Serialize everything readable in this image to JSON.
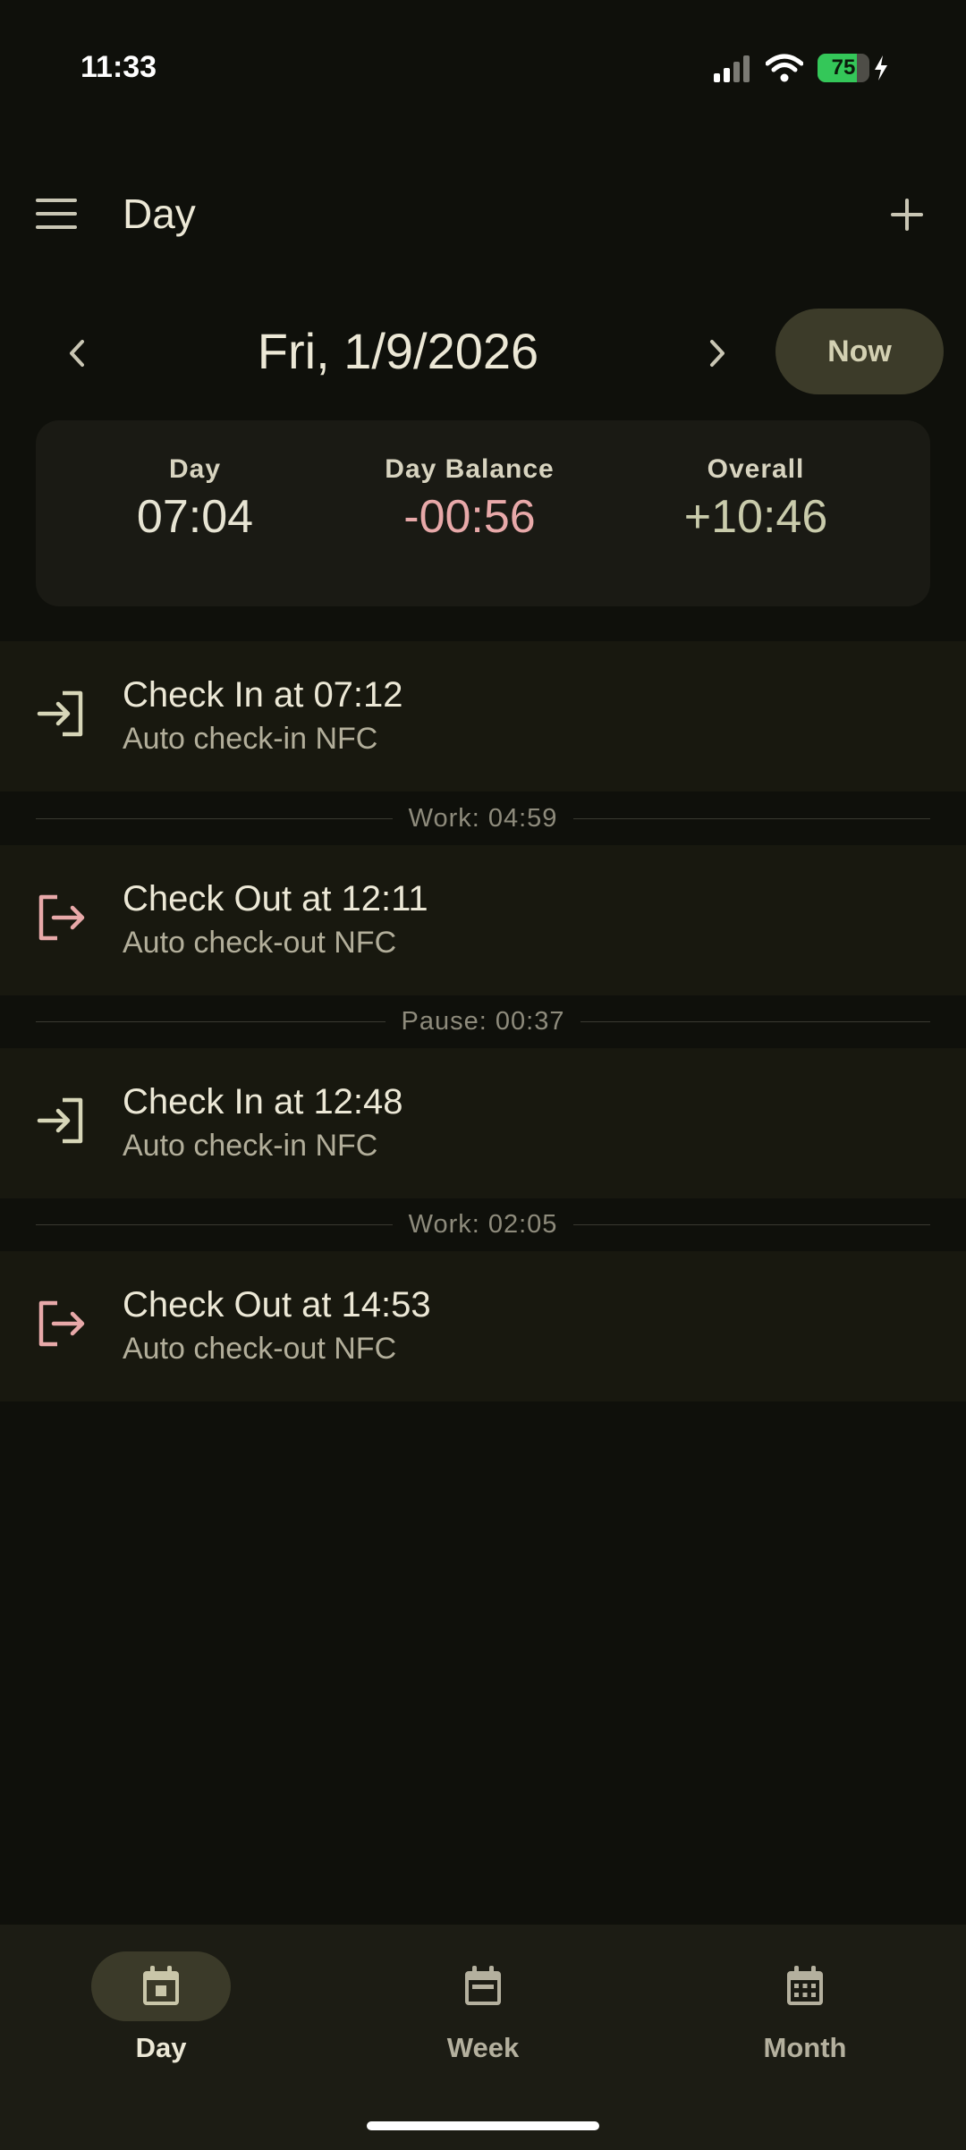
{
  "status_bar": {
    "time": "11:33",
    "battery_percent": "75"
  },
  "app_bar": {
    "title": "Day",
    "menu_icon": "menu-icon",
    "add_icon": "plus-icon"
  },
  "date_nav": {
    "date": "Fri, 1/9/2026",
    "now_label": "Now"
  },
  "summary": {
    "day": {
      "label": "Day",
      "value": "07:04"
    },
    "day_balance": {
      "label": "Day Balance",
      "value": "-00:56",
      "color": "#e8a9a9"
    },
    "overall": {
      "label": "Overall",
      "value": "+10:46",
      "color": "#c9cbab"
    }
  },
  "entries": [
    {
      "title": "Check In at 07:12",
      "subtitle": "Auto check-in NFC",
      "type": "check-in",
      "icon": "login-icon",
      "icon_color": "#d7d6b8"
    },
    {
      "title": "Check Out at 12:11",
      "subtitle": "Auto check-out NFC",
      "type": "check-out",
      "icon": "logout-icon",
      "icon_color": "#e8a9a9"
    },
    {
      "title": "Check In at 12:48",
      "subtitle": "Auto check-in NFC",
      "type": "check-in",
      "icon": "login-icon",
      "icon_color": "#d7d6b8"
    },
    {
      "title": "Check Out at 14:53",
      "subtitle": "Auto check-out NFC",
      "type": "check-out",
      "icon": "logout-icon",
      "icon_color": "#e8a9a9"
    }
  ],
  "separators": [
    "Work: 04:59",
    "Pause: 00:37",
    "Work: 02:05"
  ],
  "bottom_nav": [
    {
      "label": "Day",
      "icon": "calendar-day-icon",
      "active": true
    },
    {
      "label": "Week",
      "icon": "calendar-week-icon",
      "active": false
    },
    {
      "label": "Month",
      "icon": "calendar-month-icon",
      "active": false
    }
  ]
}
